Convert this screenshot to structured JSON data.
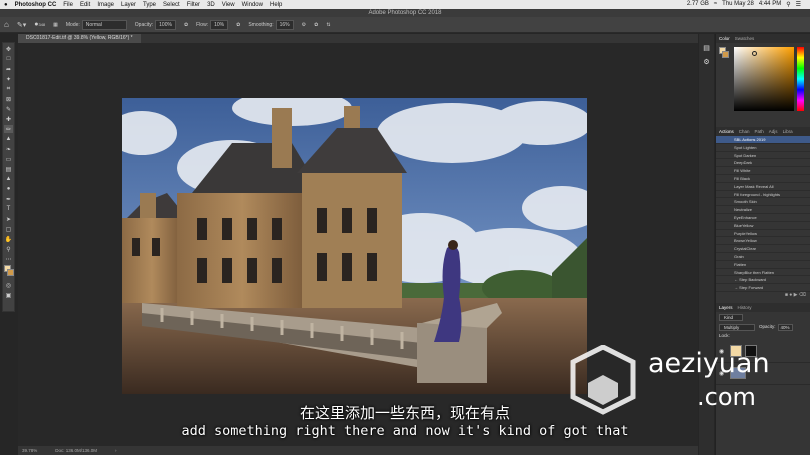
{
  "menubar": {
    "apple": "",
    "app": "Photoshop CC",
    "items": [
      "File",
      "Edit",
      "Image",
      "Layer",
      "Type",
      "Select",
      "Filter",
      "3D",
      "View",
      "Window",
      "Help"
    ],
    "status_right": [
      "2.77 GB",
      "Thu May 28",
      "4:44 PM"
    ]
  },
  "window_title": "Adobe Photoshop CC 2018",
  "options": {
    "brush_size": "348",
    "mode_label": "Mode:",
    "mode_value": "Normal",
    "opacity_label": "Opacity:",
    "opacity_value": "100%",
    "flow_label": "Flow:",
    "flow_value": "10%",
    "smoothing_label": "Smoothing:",
    "smoothing_value": "16%"
  },
  "document": {
    "tab_label": "DSC01817-Edit.tif @ 39.8% (Yellow, RGB/16*) *"
  },
  "status": {
    "zoom": "39.78%",
    "doc": "Doc: 136.0M/136.0M"
  },
  "panels": {
    "color_tabs": [
      "Color",
      "Swatches"
    ],
    "actions_tabs": [
      "Actions",
      "Chan",
      "Path",
      "Adjs",
      "Libra"
    ],
    "actions": [
      "SBL Actions 2019",
      "Spot Lighten",
      "Spot Darken",
      "DeepDark",
      "Fill White",
      "Fill Black",
      "Layer Mask Reveal All",
      "Fill foreground - highlights",
      "Smooth Skin",
      "Neutralize",
      "EyeEnhance",
      "BlueYellow",
      "PurpleYellow",
      "BrownYellow",
      "CrystalClear",
      "Grain",
      "Flatten",
      "SharpBlur then Flatten",
      "← Step Backward",
      "→ Step Forward"
    ],
    "layers_tabs": [
      "Layers",
      "History"
    ],
    "layers_kind": "Kind",
    "layers_blend": "Multiply",
    "layers_opacity_label": "Opacity:",
    "layers_opacity": "40%",
    "layers_lock_label": "Lock:"
  },
  "subtitles": {
    "cn": "在这里添加一些东西，现在有点",
    "en": "add something right there and now it's kind of got that"
  },
  "watermark": {
    "line1": "aeziyuan",
    "line2": ".com"
  },
  "colors": {
    "foreground": "#f3d9a5",
    "background": "#d09a4a",
    "selection": "#3e5a8a"
  }
}
